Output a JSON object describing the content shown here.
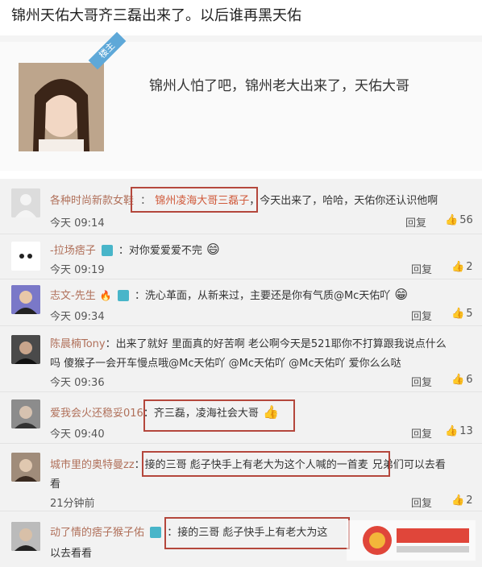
{
  "title": "锦州天佑大哥齐三磊出来了。以后谁再黑天佑",
  "post": {
    "badge": "楼主",
    "text": "锦州人怕了吧，锦州老大出来了，天佑大哥"
  },
  "comments": [
    {
      "name": "各种时尚新款女鞋",
      "text_hl": "锦州凌海大哥三磊子",
      "text": "，今天出来了，哈哈，天佑你还认识他啊",
      "time": "今天 09:14",
      "reply": "回复",
      "likes": "56"
    },
    {
      "name": "-拉场痞子",
      "text": "：对你爱爱爱不完",
      "time": "今天 09:19",
      "reply": "回复",
      "likes": "2"
    },
    {
      "name": "志文-先生",
      "text": "：洗心革面，从新来过，主要还是你有气质@Mc天佑吖",
      "time": "今天 09:34",
      "reply": "回复",
      "likes": "5"
    },
    {
      "name": "陈晨楠Tony",
      "text": "：出来了就好 里面真的好苦啊  老公啊今天是521耶你不打算跟我说点什么",
      "text2": "吗   傻猴子一会开车慢点哦@Mc天佑吖 @Mc天佑吖 @Mc天佑吖 爱你么么哒",
      "time": "今天 09:36",
      "reply": "回复",
      "likes": "6"
    },
    {
      "name": "爱我会火还稳妥016",
      "text": "：齐三磊，凌海社会大哥",
      "time": "今天 09:40",
      "reply": "回复",
      "likes": "13"
    },
    {
      "name": "城市里的奥特曼zz",
      "text": "：接的三哥  彪子快手上有老大为这个人喊的一首麦",
      "text_tail": "兄弟们可以去看",
      "text2": "看",
      "time": "21分钟前",
      "reply": "回复",
      "likes": "2"
    },
    {
      "name": "动了情的痞子猴子佑",
      "text": "：接的三哥  彪子快手上有老大为这",
      "text2": "以去看看"
    }
  ]
}
